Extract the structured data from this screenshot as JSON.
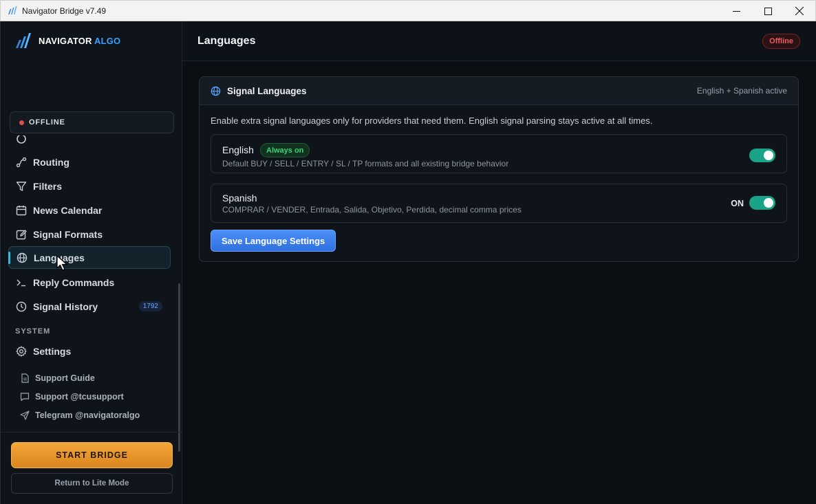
{
  "window": {
    "title": "Navigator Bridge v7.49"
  },
  "brand": {
    "name_part1": "NAVIGATOR",
    "name_part2": "ALGO",
    "accent_color": "#3aa0ff"
  },
  "status": {
    "label": "OFFLINE",
    "dot_color": "#e5484d"
  },
  "sidebar": {
    "items": [
      {
        "label": "Routing",
        "icon": "route-icon"
      },
      {
        "label": "Filters",
        "icon": "filter-icon"
      },
      {
        "label": "News Calendar",
        "icon": "calendar-icon"
      },
      {
        "label": "Signal Formats",
        "icon": "edit-icon"
      },
      {
        "label": "Languages",
        "icon": "globe-icon",
        "active": true
      },
      {
        "label": "Reply Commands",
        "icon": "terminal-icon"
      },
      {
        "label": "Signal History",
        "icon": "clock-icon",
        "badge": "1792"
      }
    ],
    "system_label": "SYSTEM",
    "settings_label": "Settings",
    "links": [
      {
        "label": "Support Guide",
        "icon": "document-icon"
      },
      {
        "label": "Support @tcusupport",
        "icon": "chat-icon"
      },
      {
        "label": "Telegram @navigatoralgo",
        "icon": "send-icon"
      }
    ],
    "start_label": "START BRIDGE",
    "lite_label": "Return to Lite Mode"
  },
  "header": {
    "title": "Languages",
    "status_badge": "Offline"
  },
  "card": {
    "title": "Signal Languages",
    "meta": "English + Spanish active",
    "description": "Enable extra signal languages only for providers that need them. English signal parsing stays active at all times.",
    "languages": [
      {
        "name": "English",
        "badge": "Always on",
        "subtitle": "Default BUY / SELL / ENTRY / SL / TP formats and all existing bridge behavior",
        "enabled": true
      },
      {
        "name": "Spanish",
        "state_label": "ON",
        "subtitle": "COMPRAR / VENDER, Entrada, Salida, Objetivo, Perdida, decimal comma prices",
        "enabled": true
      }
    ],
    "save_label": "Save Language Settings"
  }
}
